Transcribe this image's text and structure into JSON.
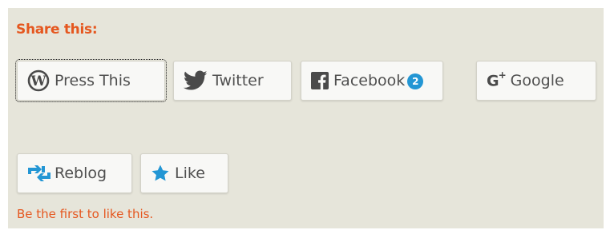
{
  "share": {
    "heading": "Share this:",
    "buttons": [
      {
        "label": "Press This",
        "icon": "wordpress-icon"
      },
      {
        "label": "Twitter",
        "icon": "twitter-icon"
      },
      {
        "label": "Facebook",
        "icon": "facebook-icon",
        "count": "2"
      },
      {
        "label": "Google",
        "icon": "google-plus-icon"
      }
    ]
  },
  "like": {
    "reblog_label": "Reblog",
    "like_label": "Like",
    "status_text": "Be the first to like this."
  },
  "colors": {
    "accent": "#e5571f",
    "icon_blue": "#2396d4",
    "panel_bg": "#e6e5da"
  }
}
